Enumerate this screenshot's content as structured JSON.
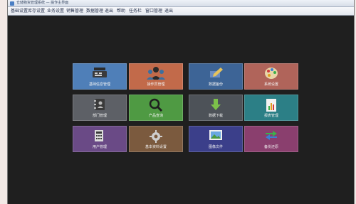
{
  "window": {
    "title": "仓储物资管理系统 — 操作主界面"
  },
  "menu": [
    {
      "label": "基础设置"
    },
    {
      "label": "库存设置"
    },
    {
      "label": "业务设置"
    },
    {
      "label": "销售管理"
    },
    {
      "label": "数据管理"
    },
    {
      "label": "退出"
    },
    {
      "label": "帮助"
    },
    {
      "label": "任务栏"
    },
    {
      "label": "窗口管理"
    },
    {
      "label": "退出"
    }
  ],
  "tiles": [
    {
      "label": "基础信息管理",
      "color": "#4f7fb8",
      "icon": "cash-register-icon"
    },
    {
      "label": "操作员管理",
      "color": "#c26a4a",
      "icon": "users-icon"
    },
    {
      "label": "数据备份",
      "color": "#3d6496",
      "icon": "edit-icon"
    },
    {
      "label": "系统设置",
      "color": "#b0645a",
      "icon": "palette-icon"
    },
    {
      "label": "部门管理",
      "color": "#5d6066",
      "icon": "address-book-icon"
    },
    {
      "label": "产品查询",
      "color": "#4f9a43",
      "icon": "search-icon"
    },
    {
      "label": "数据下载",
      "color": "#4d5258",
      "icon": "download-arrow-icon"
    },
    {
      "label": "报表管理",
      "color": "#2c7f86",
      "icon": "report-chart-icon"
    },
    {
      "label": "用户管理",
      "color": "#6a4a86",
      "icon": "calculator-icon"
    },
    {
      "label": "基本资料设置",
      "color": "#7b5a3e",
      "icon": "gear-icon"
    },
    {
      "label": "图像文件",
      "color": "#3b3f8a",
      "icon": "picture-icon"
    },
    {
      "label": "备份还原",
      "color": "#8a3f6e",
      "icon": "exchange-arrows-icon"
    }
  ]
}
